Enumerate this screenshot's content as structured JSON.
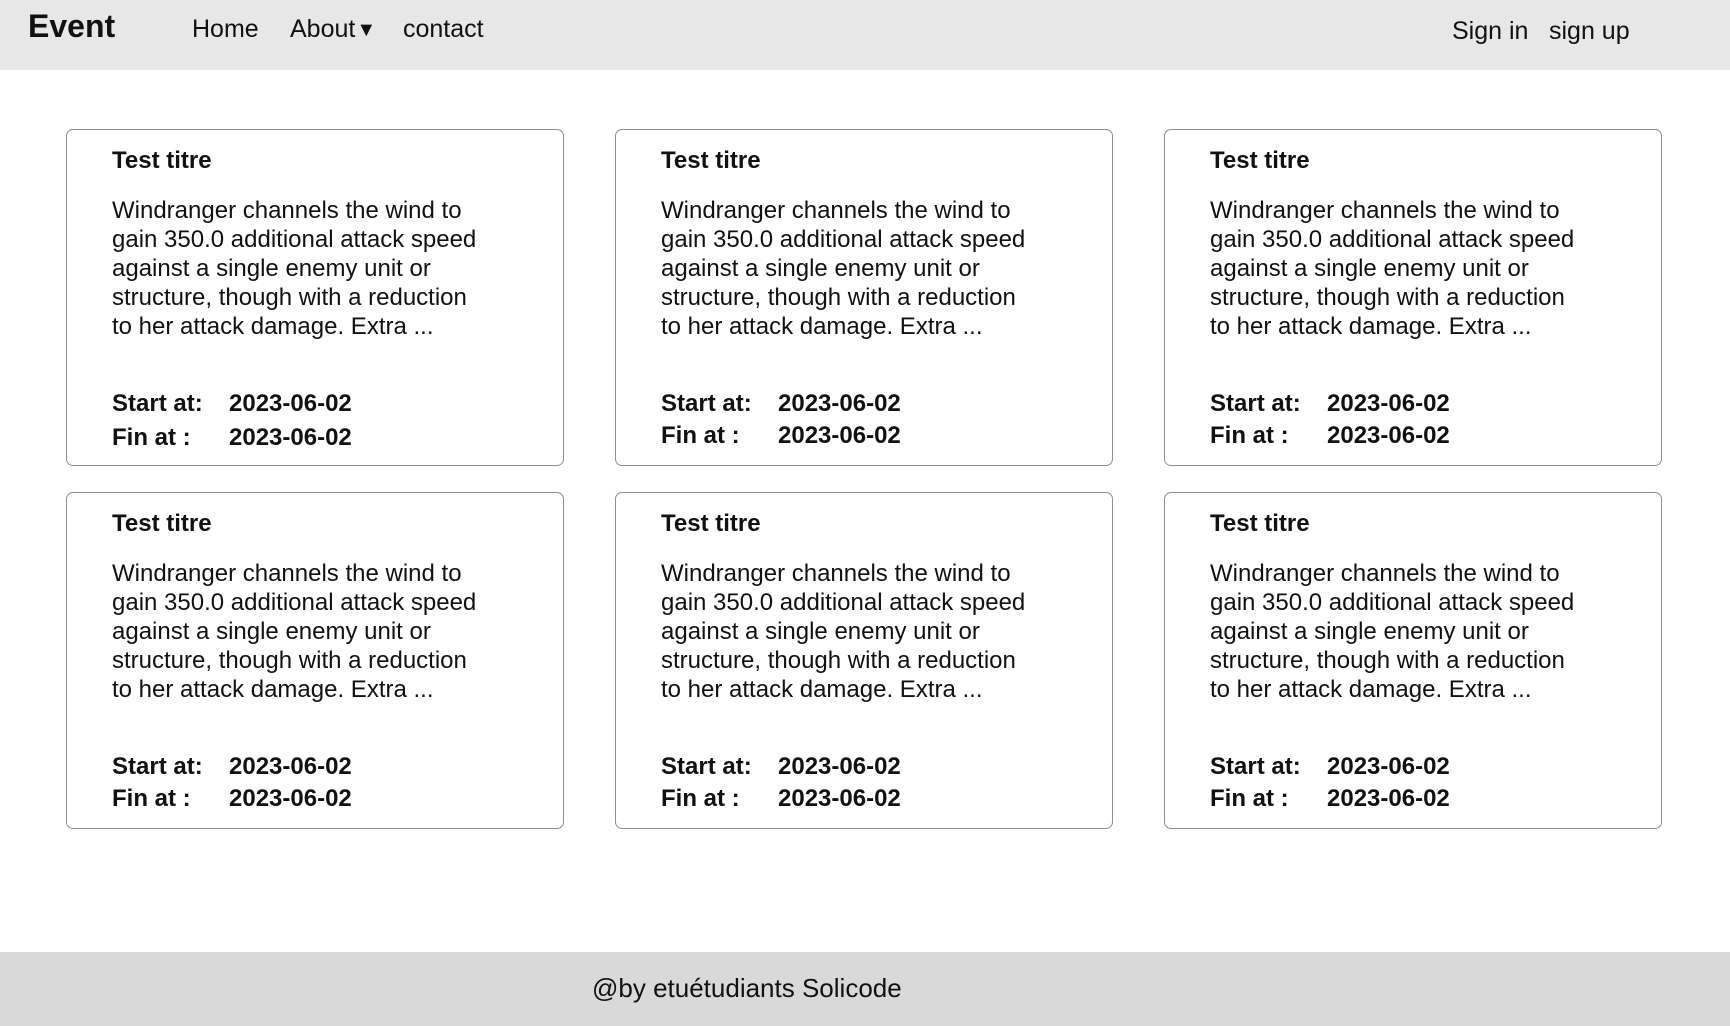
{
  "navbar": {
    "brand": "Event",
    "links": {
      "home": "Home",
      "about": "About",
      "contact": "contact"
    },
    "about_caret_icon": "caret-down-icon",
    "auth": {
      "sign_in": "Sign in",
      "sign_up": "sign up"
    }
  },
  "cards": [
    {
      "title": "Test titre",
      "description": "Windranger channels the wind to gain 350.0 additional attack speed against a single enemy unit or structure, though with a reduction to her attack damage. Extra ...",
      "start_label": "Start at:",
      "start_date": "2023-06-02",
      "fin_label": "Fin at    :",
      "fin_date": "2023-06-02"
    },
    {
      "title": "Test titre",
      "description": "Windranger channels the wind to gain 350.0 additional attack speed against a single enemy unit or structure, though with a reduction to her attack damage. Extra ...",
      "start_label": "Start at:",
      "start_date": "2023-06-02",
      "fin_label": "Fin at    :",
      "fin_date": "2023-06-02"
    },
    {
      "title": "Test titre",
      "description": "Windranger channels the wind to gain 350.0 additional attack speed against a single enemy unit or structure, though with a reduction to her attack damage. Extra ...",
      "start_label": "Start at:",
      "start_date": "2023-06-02",
      "fin_label": "Fin at    :",
      "fin_date": "2023-06-02"
    },
    {
      "title": "Test titre",
      "description": "Windranger channels the wind to gain 350.0 additional attack speed against a single enemy unit or structure, though with a reduction to her attack damage. Extra ...",
      "start_label": "Start at:",
      "start_date": "2023-06-02",
      "fin_label": "Fin at    :",
      "fin_date": "2023-06-02"
    },
    {
      "title": "Test titre",
      "description": "Windranger channels the wind to gain 350.0 additional attack speed against a single enemy unit or structure, though with a reduction to her attack damage. Extra ...",
      "start_label": "Start at:",
      "start_date": "2023-06-02",
      "fin_label": "Fin at    :",
      "fin_date": "2023-06-02"
    },
    {
      "title": "Test titre",
      "description": "Windranger channels the wind to gain 350.0 additional attack speed against a single enemy unit or structure, though with a reduction to her attack damage. Extra ...",
      "start_label": "Start at:",
      "start_date": "2023-06-02",
      "fin_label": "Fin at    :",
      "fin_date": "2023-06-02"
    }
  ],
  "footer": {
    "text": "@by etuétudiants Solicode"
  },
  "colors": {
    "navbar_background": "#e7e7e7",
    "footer_background": "#d9d9d9",
    "card_border": "#8e8e8e",
    "text": "#111111"
  }
}
